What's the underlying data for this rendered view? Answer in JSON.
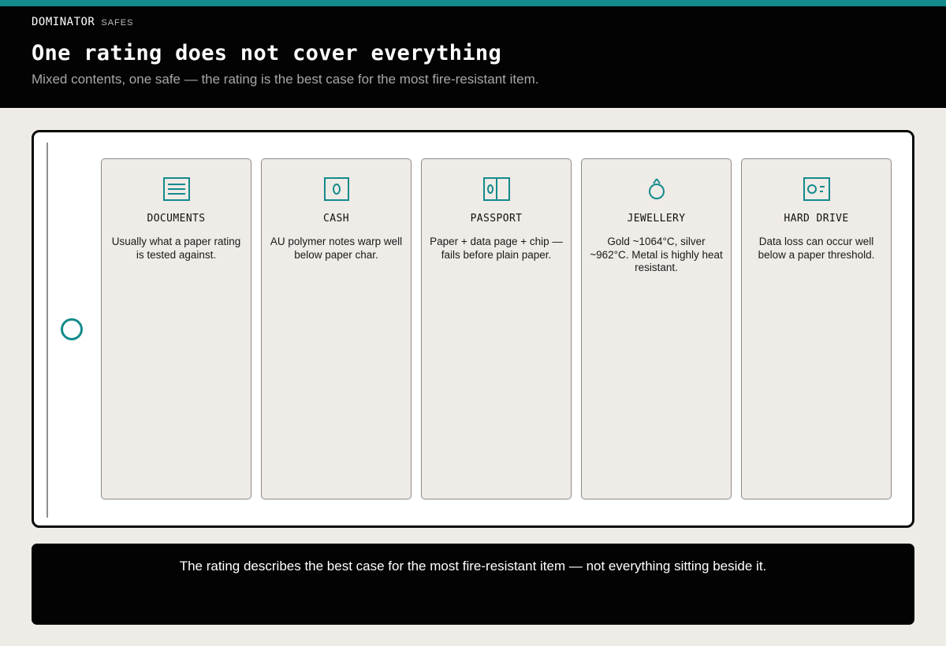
{
  "brand": {
    "name": "DOMINATOR",
    "sub": "SAFES"
  },
  "header": {
    "title": "One rating does not cover everything",
    "subtitle": "Mixed contents, one safe — the rating is the best case for the most fire-resistant item."
  },
  "colors": {
    "accent": "#138b8b",
    "dark": "#030303",
    "background": "#efebe7"
  },
  "cards": [
    {
      "icon": "document-icon",
      "label": "DOCUMENTS",
      "text": "Usually what a paper rating is tested against."
    },
    {
      "icon": "cash-icon",
      "label": "CASH",
      "text": "AU polymer notes warp well below paper char."
    },
    {
      "icon": "passport-icon",
      "label": "PASSPORT",
      "text": "Paper + data page + chip — fails before plain paper."
    },
    {
      "icon": "jewellery-icon",
      "label": "JEWELLERY",
      "text": "Gold ~1064°C, silver ~962°C. Metal is highly heat resistant."
    },
    {
      "icon": "hard-drive-icon",
      "label": "HARD DRIVE",
      "text": "Data loss can occur well below a paper threshold."
    }
  ],
  "footer": {
    "text": "The rating describes the best case for the most fire-resistant item — not everything sitting beside it."
  }
}
